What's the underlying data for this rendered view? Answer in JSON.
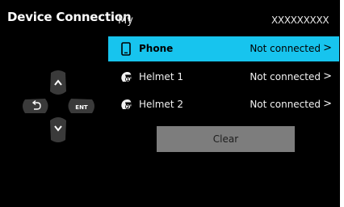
{
  "header": {
    "title": "Device Connection",
    "device_label": "My",
    "device_id": "XXXXXXXXX"
  },
  "devices": [
    {
      "name": "Phone",
      "status": "Not connected",
      "chevron": ">",
      "icon": "phone-icon",
      "selected": true
    },
    {
      "name": "Helmet 1",
      "status": "Not connected",
      "chevron": ">",
      "icon": "helmet-1-icon",
      "selected": false
    },
    {
      "name": "Helmet 2",
      "status": "Not connected",
      "chevron": ">",
      "icon": "helmet-2-icon",
      "selected": false
    }
  ],
  "clear_button": {
    "label": "Clear"
  },
  "dpad": {
    "up": "up-arrow-icon",
    "down": "down-arrow-icon",
    "back": "back-icon",
    "enter_label": "ENT"
  },
  "colors": {
    "background": "#000000",
    "accent": "#17c4ee",
    "button": "#7d7d7d",
    "dpad": "#3a3a3a"
  }
}
